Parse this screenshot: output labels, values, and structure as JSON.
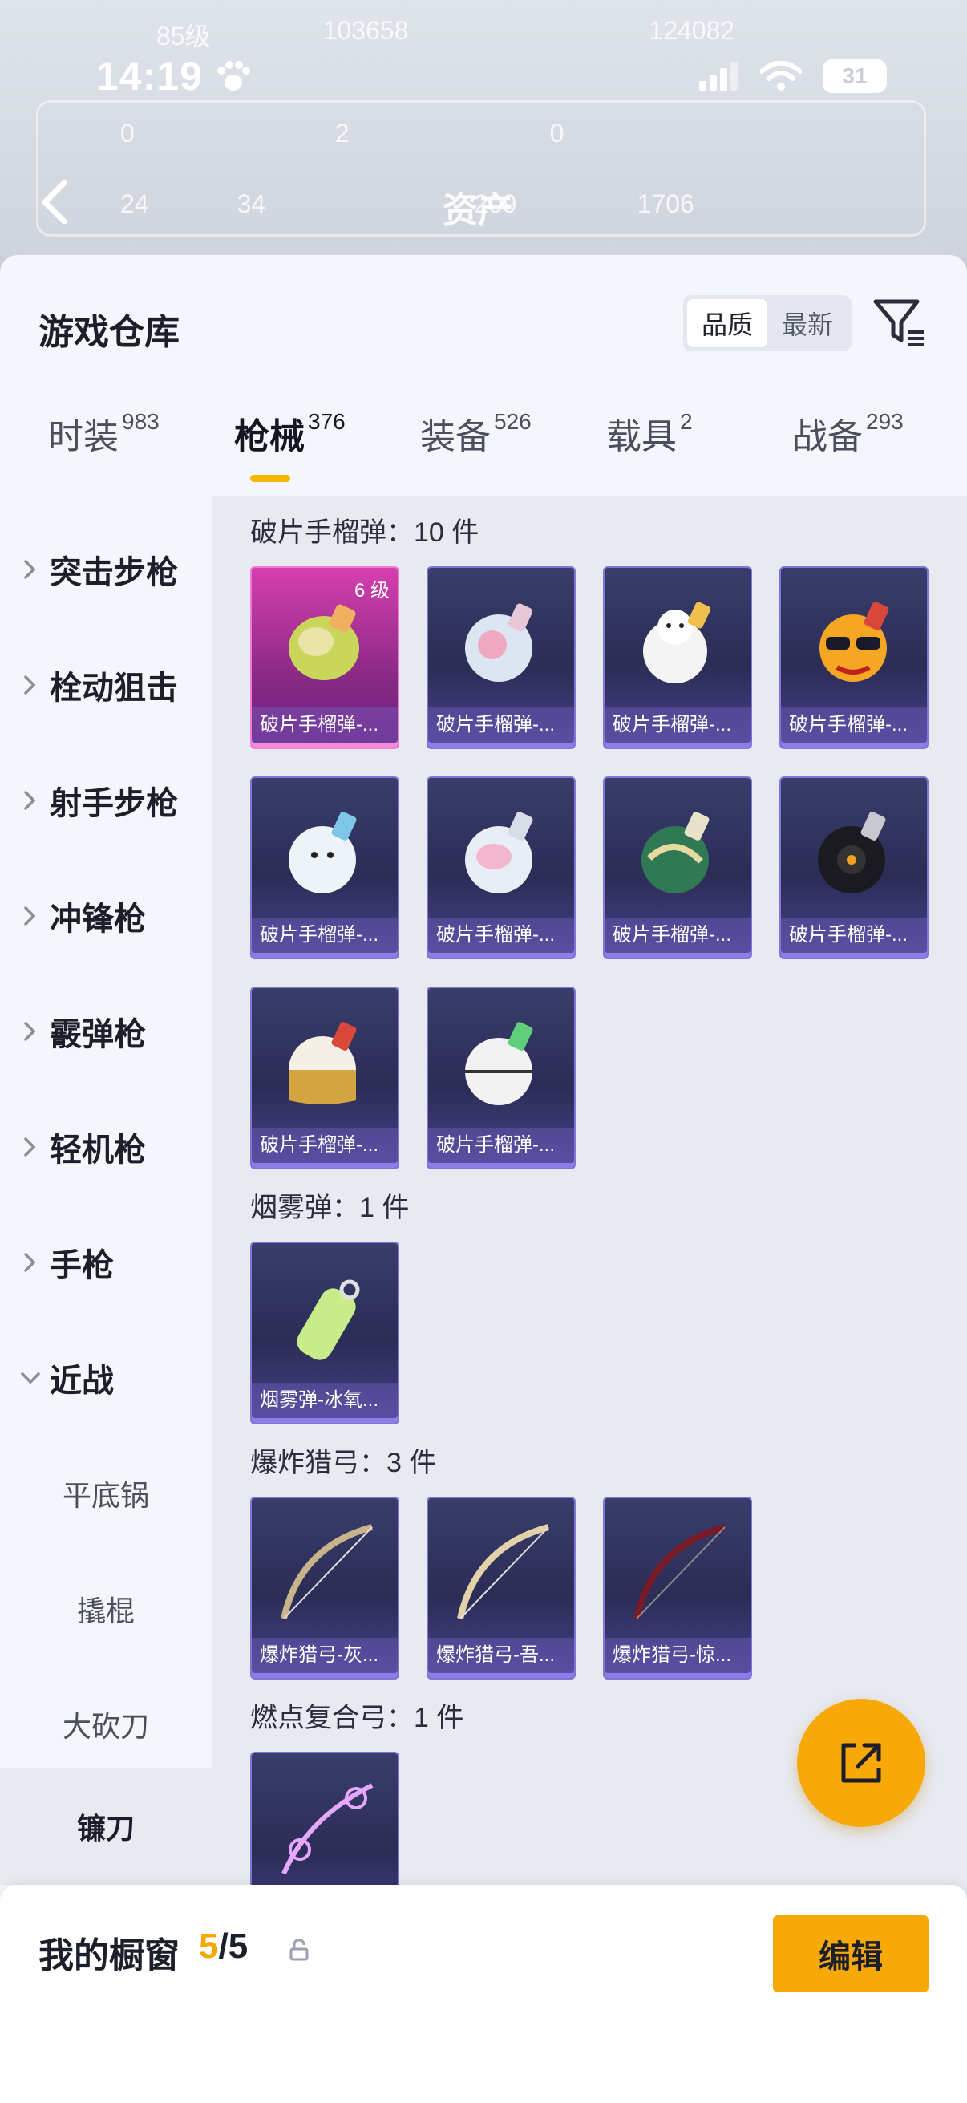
{
  "status_bar": {
    "time": "14:19",
    "battery": "31"
  },
  "background_header": {
    "title": "资产",
    "row1": [
      "85级",
      "103658",
      "124082"
    ],
    "row2": [
      "0",
      "2",
      "0"
    ],
    "row3": [
      "24",
      "34",
      "209",
      "1706"
    ]
  },
  "panel": {
    "title": "游戏仓库",
    "sort_options": [
      "品质",
      "最新"
    ],
    "sort_active": "品质"
  },
  "tabs": [
    {
      "label": "时装",
      "count": "983"
    },
    {
      "label": "枪械",
      "count": "376"
    },
    {
      "label": "装备",
      "count": "526"
    },
    {
      "label": "载具",
      "count": "2"
    },
    {
      "label": "战备",
      "count": "293"
    }
  ],
  "sidebar": {
    "categories": [
      "突击步枪",
      "栓动狙击",
      "射手步枪",
      "冲锋枪",
      "霰弹枪",
      "轻机枪",
      "手枪",
      "近战"
    ],
    "subcategories": [
      "平底锅",
      "撬棍",
      "大砍刀",
      "镰刀"
    ]
  },
  "sections": [
    {
      "title": "破片手榴弹：10 件",
      "items": [
        {
          "label": "破片手榴弹-...",
          "level": "6 级",
          "rarity": "pink"
        },
        {
          "label": "破片手榴弹-..."
        },
        {
          "label": "破片手榴弹-..."
        },
        {
          "label": "破片手榴弹-..."
        },
        {
          "label": "破片手榴弹-..."
        },
        {
          "label": "破片手榴弹-..."
        },
        {
          "label": "破片手榴弹-..."
        },
        {
          "label": "破片手榴弹-..."
        },
        {
          "label": "破片手榴弹-..."
        },
        {
          "label": "破片手榴弹-..."
        }
      ]
    },
    {
      "title": "烟雾弹：1 件",
      "items": [
        {
          "label": "烟雾弹-冰氧..."
        }
      ]
    },
    {
      "title": "爆炸猎弓：3 件",
      "items": [
        {
          "label": "爆炸猎弓-灰..."
        },
        {
          "label": "爆炸猎弓-吾..."
        },
        {
          "label": "爆炸猎弓-惊..."
        }
      ]
    },
    {
      "title": "燃点复合弓：1 件",
      "items": [
        {
          "label": ""
        }
      ]
    }
  ],
  "bottom_bar": {
    "title": "我的橱窗",
    "current": "5",
    "total": "/5",
    "edit_label": "编辑"
  },
  "colors": {
    "accent": "#f7a90a",
    "item_border": "#7f76d6",
    "legendary": "#d63fae"
  }
}
